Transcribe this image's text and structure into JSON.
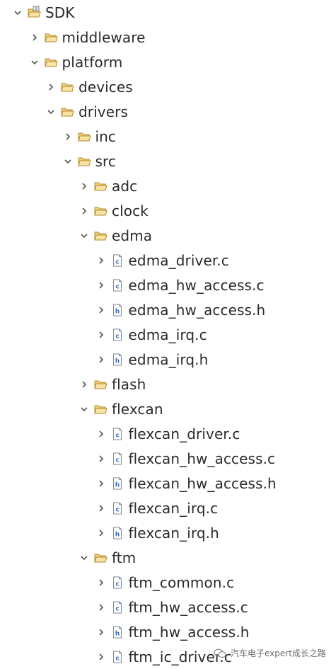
{
  "tree": [
    {
      "label": "SDK",
      "level": 0,
      "expanded": true,
      "kind": "project"
    },
    {
      "label": "middleware",
      "level": 1,
      "expanded": false,
      "kind": "folder"
    },
    {
      "label": "platform",
      "level": 1,
      "expanded": true,
      "kind": "folder"
    },
    {
      "label": "devices",
      "level": 2,
      "expanded": false,
      "kind": "folder"
    },
    {
      "label": "drivers",
      "level": 2,
      "expanded": true,
      "kind": "folder"
    },
    {
      "label": "inc",
      "level": 3,
      "expanded": false,
      "kind": "folder"
    },
    {
      "label": "src",
      "level": 3,
      "expanded": true,
      "kind": "folder"
    },
    {
      "label": "adc",
      "level": 4,
      "expanded": false,
      "kind": "folder"
    },
    {
      "label": "clock",
      "level": 4,
      "expanded": false,
      "kind": "folder"
    },
    {
      "label": "edma",
      "level": 4,
      "expanded": true,
      "kind": "folder"
    },
    {
      "label": "edma_driver.c",
      "level": 5,
      "expanded": false,
      "kind": "c"
    },
    {
      "label": "edma_hw_access.c",
      "level": 5,
      "expanded": false,
      "kind": "c"
    },
    {
      "label": "edma_hw_access.h",
      "level": 5,
      "expanded": false,
      "kind": "h"
    },
    {
      "label": "edma_irq.c",
      "level": 5,
      "expanded": false,
      "kind": "c"
    },
    {
      "label": "edma_irq.h",
      "level": 5,
      "expanded": false,
      "kind": "h"
    },
    {
      "label": "flash",
      "level": 4,
      "expanded": false,
      "kind": "folder"
    },
    {
      "label": "flexcan",
      "level": 4,
      "expanded": true,
      "kind": "folder"
    },
    {
      "label": "flexcan_driver.c",
      "level": 5,
      "expanded": false,
      "kind": "c"
    },
    {
      "label": "flexcan_hw_access.c",
      "level": 5,
      "expanded": false,
      "kind": "c"
    },
    {
      "label": "flexcan_hw_access.h",
      "level": 5,
      "expanded": false,
      "kind": "h"
    },
    {
      "label": "flexcan_irq.c",
      "level": 5,
      "expanded": false,
      "kind": "c"
    },
    {
      "label": "flexcan_irq.h",
      "level": 5,
      "expanded": false,
      "kind": "h"
    },
    {
      "label": "ftm",
      "level": 4,
      "expanded": true,
      "kind": "folder"
    },
    {
      "label": "ftm_common.c",
      "level": 5,
      "expanded": false,
      "kind": "c"
    },
    {
      "label": "ftm_hw_access.c",
      "level": 5,
      "expanded": false,
      "kind": "c"
    },
    {
      "label": "ftm_hw_access.h",
      "level": 5,
      "expanded": false,
      "kind": "h"
    },
    {
      "label": "ftm_ic_driver.c",
      "level": 5,
      "expanded": false,
      "kind": "c"
    }
  ],
  "icons": {
    "chevron_expanded": "chevron-down-icon",
    "chevron_collapsed": "chevron-right-icon",
    "project": "project-folder-icon",
    "folder": "folder-open-icon",
    "c": "c-file-icon",
    "h": "h-file-icon"
  },
  "colors": {
    "folder_fill": "#f3d27a",
    "folder_stroke": "#b08a2e",
    "file_accent": "#3d6fb5",
    "chevron": "#555555",
    "text": "#2a2a2a"
  },
  "watermark": {
    "text": "汽车电子expert成长之路"
  }
}
